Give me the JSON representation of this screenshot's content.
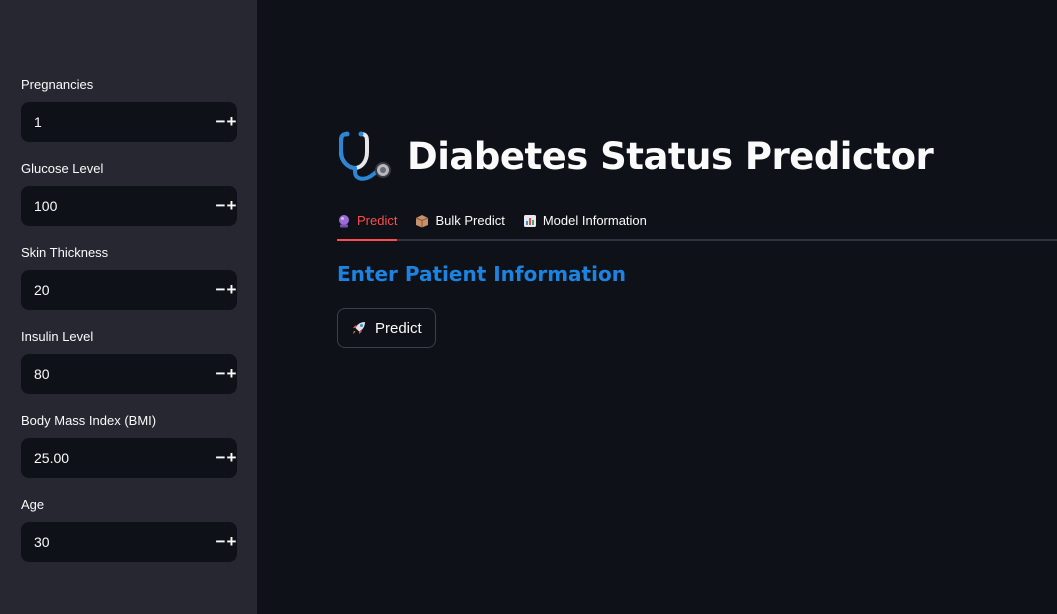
{
  "sidebar": {
    "fields": [
      {
        "label": "Pregnancies",
        "value": "1"
      },
      {
        "label": "Glucose Level",
        "value": "100"
      },
      {
        "label": "Skin Thickness",
        "value": "20"
      },
      {
        "label": "Insulin Level",
        "value": "80"
      },
      {
        "label": "Body Mass Index (BMI)",
        "value": "25.00"
      },
      {
        "label": "Age",
        "value": "30"
      }
    ],
    "decrement_symbol": "−",
    "increment_symbol": "+"
  },
  "main": {
    "title": "Diabetes Status Predictor",
    "title_icon": "stethoscope-icon",
    "tabs": [
      {
        "label": "Predict",
        "icon": "crystal-ball-icon",
        "active": true
      },
      {
        "label": "Bulk Predict",
        "icon": "package-icon",
        "active": false
      },
      {
        "label": "Model Information",
        "icon": "bar-chart-icon",
        "active": false
      }
    ],
    "section_heading": "Enter Patient Information",
    "predict_button": {
      "label": "Predict",
      "icon": "rocket-icon"
    }
  },
  "colors": {
    "sidebar_bg": "#262730",
    "main_bg": "#0e1117",
    "accent": "#ff4b4b",
    "heading_blue": "#1c83e1"
  }
}
